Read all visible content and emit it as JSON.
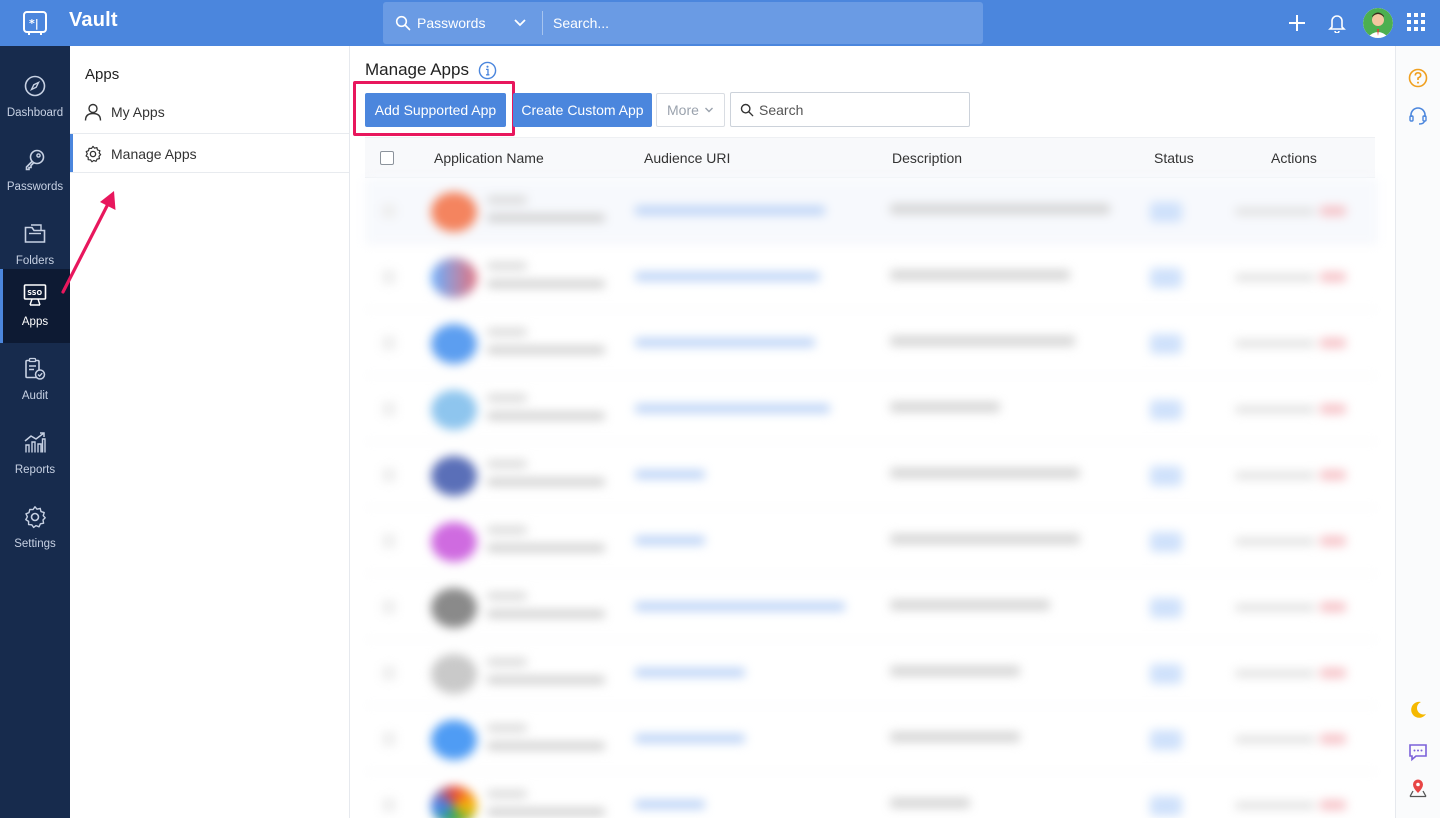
{
  "app": {
    "name": "Vault",
    "colors": {
      "topbar": "#4b86dd",
      "nav": "#172b4d",
      "accent": "#4b86dd",
      "highlight": "#e8175d"
    }
  },
  "topbar": {
    "search_scope": "Passwords",
    "search_placeholder": "Search...",
    "icons": [
      "vault-logo-icon",
      "search-icon",
      "chevron-down-icon",
      "plus-icon",
      "bell-icon",
      "avatar",
      "apps-grid-icon"
    ]
  },
  "leftnav": {
    "items": [
      {
        "label": "Dashboard",
        "icon": "compass-icon"
      },
      {
        "label": "Passwords",
        "icon": "key-icon"
      },
      {
        "label": "Folders",
        "icon": "folder-icon"
      },
      {
        "label": "Apps",
        "icon": "sso-monitor-icon",
        "active": true
      },
      {
        "label": "Audit",
        "icon": "clipboard-check-icon"
      },
      {
        "label": "Reports",
        "icon": "chart-icon"
      },
      {
        "label": "Settings",
        "icon": "gear-icon"
      }
    ]
  },
  "subnav": {
    "title": "Apps",
    "items": [
      {
        "label": "My Apps",
        "icon": "user-icon"
      },
      {
        "label": "Manage Apps",
        "icon": "gear-icon",
        "active": true
      }
    ]
  },
  "main": {
    "title": "Manage Apps",
    "toolbar": {
      "add_supported": "Add Supported App",
      "create_custom": "Create Custom App",
      "more": "More",
      "search_placeholder": "Search"
    },
    "table": {
      "columns": [
        "Application Name",
        "Audience URI",
        "Description",
        "Status",
        "Actions"
      ]
    }
  }
}
